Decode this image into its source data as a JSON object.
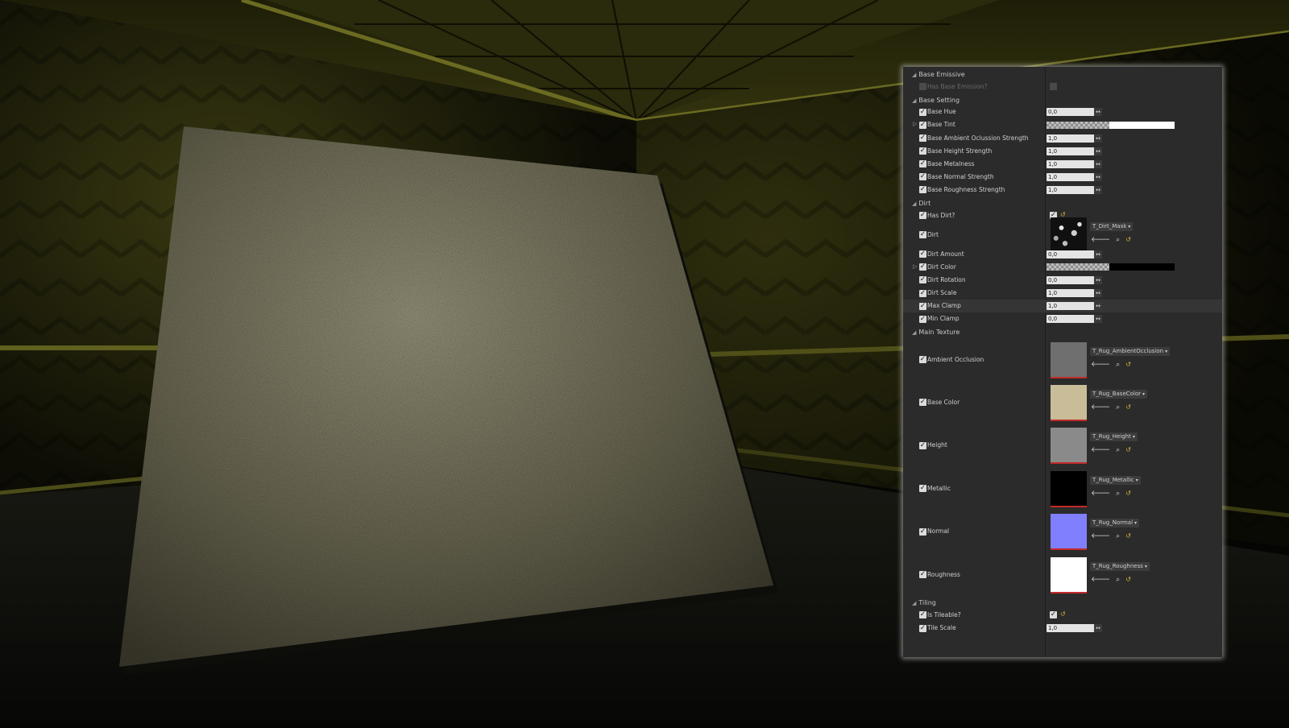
{
  "panel": {
    "sections": [
      {
        "title": "Base Emissive",
        "rows": [
          {
            "label": "Has Base Emission?",
            "type": "bool",
            "enabled": false,
            "checked": false
          }
        ]
      },
      {
        "title": "Base Setting",
        "rows": [
          {
            "label": "Base Hue",
            "type": "number",
            "value": "0,0"
          },
          {
            "label": "Base Tint",
            "type": "color",
            "color": "#ffffff",
            "expandable": true
          },
          {
            "label": "Base Ambient Oclussion Strength",
            "type": "number",
            "value": "1,0"
          },
          {
            "label": "Base Height Strength",
            "type": "number",
            "value": "1,0"
          },
          {
            "label": "Base Metalness",
            "type": "number",
            "value": "1,0"
          },
          {
            "label": "Base Normal Strength",
            "type": "number",
            "value": "1,0"
          },
          {
            "label": "Base Roughness Strength",
            "type": "number",
            "value": "1,0"
          }
        ]
      },
      {
        "title": "Dirt",
        "rows": [
          {
            "label": "Has Dirt?",
            "type": "bool",
            "checked": true
          },
          {
            "label": "Dirt",
            "type": "texture",
            "asset": "T_Dirt_Mask",
            "swatch": "dirt",
            "small": true
          },
          {
            "label": "Dirt Amount",
            "type": "number",
            "value": "0,0"
          },
          {
            "label": "Dirt Color",
            "type": "color",
            "color": "#000000",
            "expandable": true
          },
          {
            "label": "Dirt Rotation",
            "type": "number",
            "value": "0,0"
          },
          {
            "label": "Dirt Scale",
            "type": "number",
            "value": "1,0"
          },
          {
            "label": "Max Clamp",
            "type": "number",
            "value": "1,0",
            "highlight": true
          },
          {
            "label": "Min Clamp",
            "type": "number",
            "value": "0,0"
          }
        ]
      },
      {
        "title": "Main Texture",
        "rows": [
          {
            "label": "Ambient Occlusion",
            "type": "texture",
            "asset": "T_Rug_AmbientOcclusion",
            "swatch": "#6f6f6f"
          },
          {
            "label": "Base Color",
            "type": "texture",
            "asset": "T_Rug_BaseColor",
            "swatch": "#c8bd98"
          },
          {
            "label": "Height",
            "type": "texture",
            "asset": "T_Rug_Height",
            "swatch": "#8a8a8a"
          },
          {
            "label": "Metallic",
            "type": "texture",
            "asset": "T_Rug_Metallic",
            "swatch": "#000000"
          },
          {
            "label": "Normal",
            "type": "texture",
            "asset": "T_Rug_Normal",
            "swatch": "#8080ff"
          },
          {
            "label": "Roughness",
            "type": "texture",
            "asset": "T_Rug_Roughness",
            "swatch": "#ffffff"
          }
        ]
      },
      {
        "title": "Tiling",
        "rows": [
          {
            "label": "Is Tileable?",
            "type": "bool",
            "checked": true
          },
          {
            "label": "Tile Scale",
            "type": "number",
            "value": "1,0"
          }
        ]
      }
    ]
  },
  "icons": {
    "checkmark": "✓",
    "expand_arrow": "▷",
    "collapse_arrow": "◢",
    "spin_arrow": "↔",
    "use_selected": "🡐",
    "browse": "⌕",
    "reset": "↺",
    "dropdown": "▾"
  },
  "colors": {
    "panel_bg": "#2b2b2b",
    "reset_yellow": "#d2b73c",
    "texture_underline": "#c22a2a",
    "wall_tint": "#3a3a10"
  }
}
